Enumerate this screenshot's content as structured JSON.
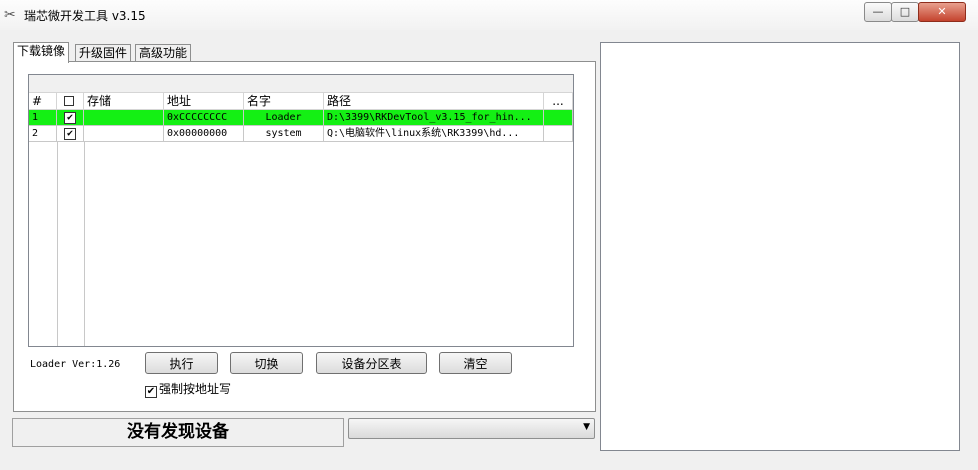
{
  "window": {
    "title": "瑞芯微开发工具 v3.15",
    "min_label": "—",
    "max_label": "□",
    "close_label": "✕"
  },
  "tabs": [
    "下载镜像",
    "升级固件",
    "高级功能"
  ],
  "table": {
    "columns": [
      "#",
      "",
      "存储",
      "地址",
      "名字",
      "路径",
      "..."
    ],
    "rows": [
      {
        "index": "1",
        "checked": true,
        "storage": "",
        "address": "0xCCCCCCCC",
        "name": "Loader",
        "path": "D:\\3399\\RKDevTool_v3.15_for_hin...",
        "selected": true
      },
      {
        "index": "2",
        "checked": true,
        "storage": "",
        "address": "0x00000000",
        "name": "system",
        "path": "Q:\\电脑软件\\linux系统\\RK3399\\hd...",
        "selected": false
      }
    ]
  },
  "loader_ver": "Loader Ver:1.26",
  "buttons": {
    "run": "执行",
    "switch": "切换",
    "partition": "设备分区表",
    "clear": "清空"
  },
  "force_write": {
    "label": "强制按地址写",
    "checked": true
  },
  "status": "没有发现设备",
  "device_combo": {
    "value": ""
  },
  "colors": {
    "selected_row": "#14f014",
    "window_bg": "#f0f0f0"
  }
}
